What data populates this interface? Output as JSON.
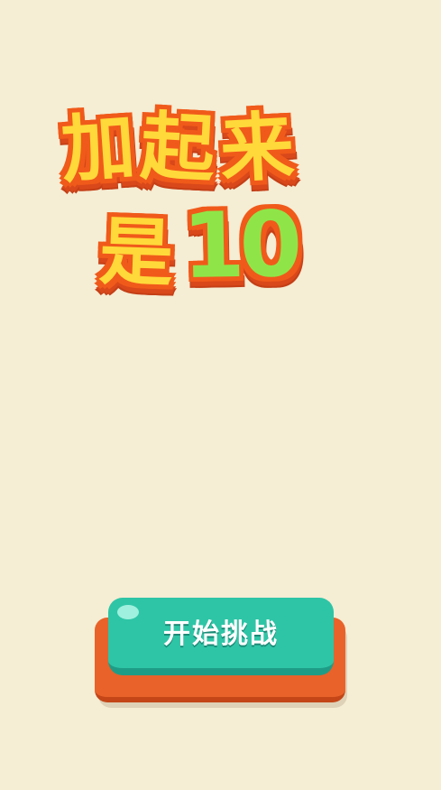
{
  "title": {
    "line1": [
      "加",
      "起",
      "来"
    ],
    "line2_char": "是",
    "line2_number": "10"
  },
  "start_button": {
    "label": "开始挑战"
  },
  "colors": {
    "background": "#f5edd4",
    "title_fill": "#ffd93a",
    "title_outline": "#f05a1a",
    "number_fill": "#8fe548",
    "button_top": "#2ec5a6",
    "button_base": "#e8622a"
  }
}
